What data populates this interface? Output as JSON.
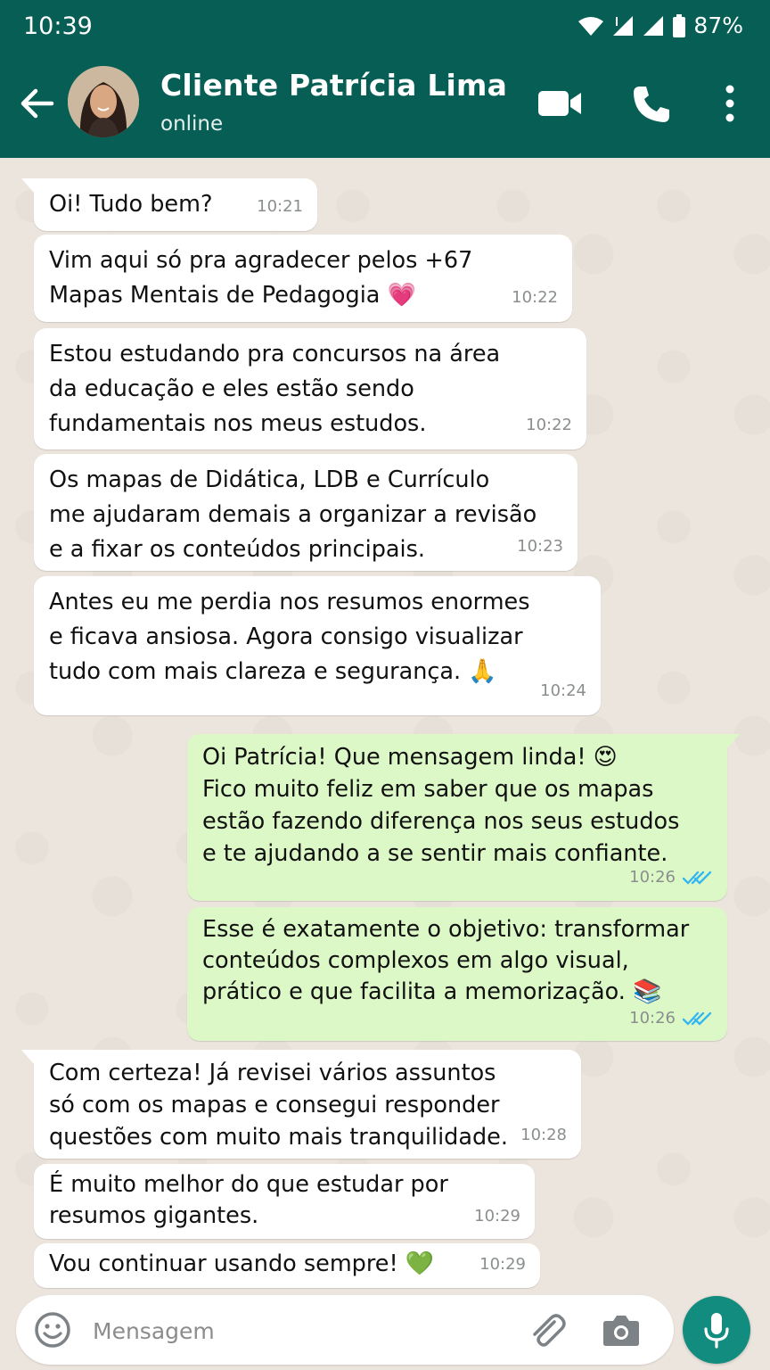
{
  "status_bar": {
    "time": "10:39",
    "battery": "87%"
  },
  "header": {
    "contact_name": "Cliente Patrícia Lima",
    "status": "online"
  },
  "messages": [
    {
      "dir": "in",
      "text": "Oi! Tudo bem?",
      "time": "10:21"
    },
    {
      "dir": "in",
      "text": "Vim aqui só pra agradecer pelos +67\nMapas Mentais de Pedagogia",
      "emoji": "💗",
      "time": "10:22"
    },
    {
      "dir": "in",
      "text": "Estou estudando pra concursos na área\nda educação e eles estão sendo\nfundamentais nos meus estudos.",
      "time": "10:22"
    },
    {
      "dir": "in",
      "text": "Os mapas de Didática, LDB e Currículo\nme ajudaram demais a organizar a revisão\ne a fixar os conteúdos principais.",
      "time": "10:23"
    },
    {
      "dir": "in",
      "text": "Antes eu me perdia nos resumos enormes\ne ficava ansiosa. Agora consigo visualizar\ntudo com mais clareza e segurança.",
      "emoji": "🙏",
      "time": "10:24"
    },
    {
      "dir": "out",
      "text": "Oi Patrícia! Que mensagem linda!",
      "emoji": "😍",
      "text2": "Fico muito feliz em saber que os mapas\nestão fazendo diferença nos seus estudos\ne te ajudando a se sentir mais confiante.",
      "time": "10:26",
      "read": true
    },
    {
      "dir": "out",
      "text": "Esse é exatamente o objetivo: transformar\nconteúdos complexos em algo visual,\nprático e que facilita a memorização.",
      "emoji": "📚",
      "time": "10:26",
      "read": true
    },
    {
      "dir": "in",
      "text": "Com certeza! Já revisei vários assuntos\nsó com os mapas e consegui responder\nquestões com muito mais tranquilidade.",
      "time": "10:28"
    },
    {
      "dir": "in",
      "text": "É muito melhor do que estudar por\nresumos gigantes.",
      "time": "10:29"
    },
    {
      "dir": "in",
      "text": "Vou continuar usando sempre!",
      "emoji": "💚",
      "time": "10:29"
    }
  ],
  "input": {
    "placeholder": "Mensagem"
  },
  "colors": {
    "header": "#075e54",
    "incoming": "#ffffff",
    "outgoing": "#dcf8c6",
    "read_ticks": "#34b7f1",
    "mic_button": "#128c7e"
  }
}
